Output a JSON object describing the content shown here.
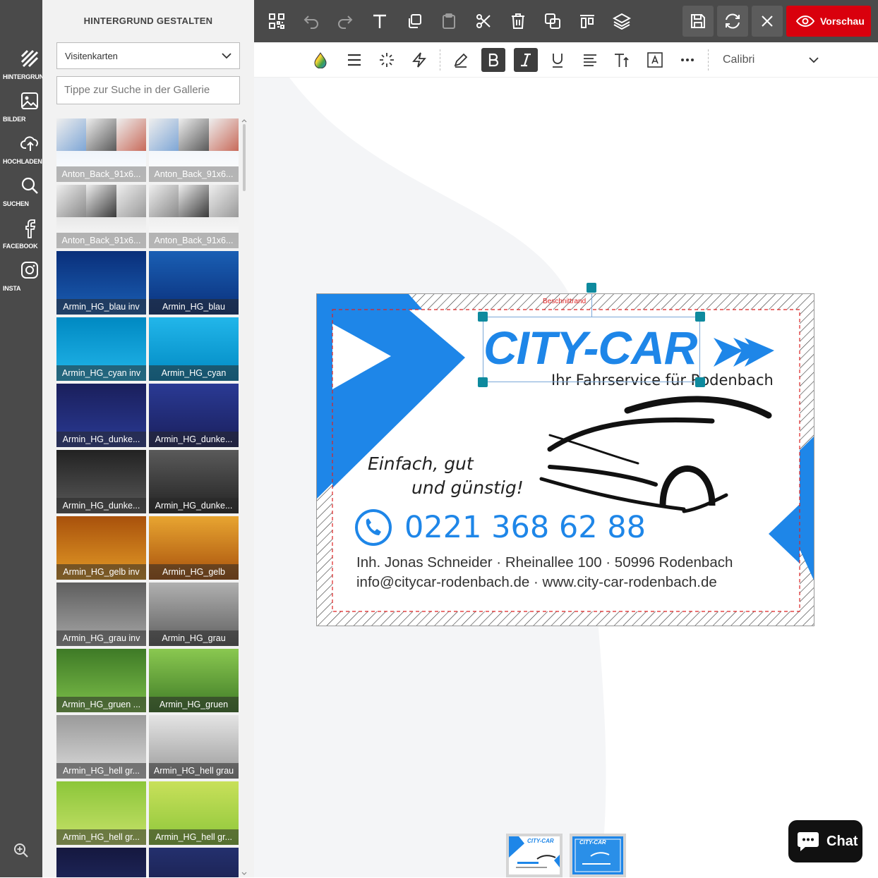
{
  "rail": {
    "items": [
      {
        "label": "HINTERGRUND",
        "icon": "background-stripes-icon"
      },
      {
        "label": "BILDER",
        "icon": "image-icon"
      },
      {
        "label": "HOCHLADEN",
        "icon": "upload-cloud-icon"
      },
      {
        "label": "SUCHEN",
        "icon": "search-icon"
      },
      {
        "label": "FACEBOOK",
        "icon": "facebook-icon"
      },
      {
        "label": "INSTA",
        "icon": "instagram-icon"
      }
    ],
    "zoom_icon": "zoom-in-icon"
  },
  "panel": {
    "title": "HINTERGRUND GESTALTEN",
    "category": "Visitenkarten",
    "search_placeholder": "Tippe zur Suche in der Gallerie",
    "tiles": [
      {
        "caption": "Anton_Back_91x6...",
        "c1": "#dfe9f5",
        "c2": "#ffffff"
      },
      {
        "caption": "Anton_Back_91x6...",
        "c1": "#e8eef6",
        "c2": "#ffffff"
      },
      {
        "caption": "Anton_Back_91x6...",
        "c1": "#cfcfcf",
        "c2": "#ffffff"
      },
      {
        "caption": "Anton_Back_91x6...",
        "c1": "#dcdcdc",
        "c2": "#ffffff"
      },
      {
        "caption": "Armin_HG_blau inv",
        "c1": "#0a2f7a",
        "c2": "#1a5fb4"
      },
      {
        "caption": "Armin_HG_blau",
        "c1": "#1a5fb4",
        "c2": "#0a2f7a"
      },
      {
        "caption": "Armin_HG_cyan inv",
        "c1": "#0089c2",
        "c2": "#22b6ea"
      },
      {
        "caption": "Armin_HG_cyan",
        "c1": "#22b6ea",
        "c2": "#0089c2"
      },
      {
        "caption": "Armin_HG_dunke...",
        "c1": "#1a1f5c",
        "c2": "#2a3a94"
      },
      {
        "caption": "Armin_HG_dunke...",
        "c1": "#2a3a94",
        "c2": "#1a1f5c"
      },
      {
        "caption": "Armin_HG_dunke...",
        "c1": "#222222",
        "c2": "#5a5a5a"
      },
      {
        "caption": "Armin_HG_dunke...",
        "c1": "#5a5a5a",
        "c2": "#222222"
      },
      {
        "caption": "Armin_HG_gelb inv",
        "c1": "#a8510c",
        "c2": "#e39a26"
      },
      {
        "caption": "Armin_HG_gelb",
        "c1": "#e8a531",
        "c2": "#a8510c"
      },
      {
        "caption": "Armin_HG_grau inv",
        "c1": "#5e5e5e",
        "c2": "#a8a8a8"
      },
      {
        "caption": "Armin_HG_grau",
        "c1": "#b0b0b0",
        "c2": "#5e5e5e"
      },
      {
        "caption": "Armin_HG_gruen ...",
        "c1": "#3e7a26",
        "c2": "#7ec04a"
      },
      {
        "caption": "Armin_HG_gruen",
        "c1": "#8ac850",
        "c2": "#3e7a26"
      },
      {
        "caption": "Armin_HG_hell gr...",
        "c1": "#9a9a9a",
        "c2": "#dcdcdc"
      },
      {
        "caption": "Armin_HG_hell grau",
        "c1": "#e4e4e4",
        "c2": "#9a9a9a"
      },
      {
        "caption": "Armin_HG_hell gr...",
        "c1": "#8cc63a",
        "c2": "#c8e26a"
      },
      {
        "caption": "Armin_HG_hell gr...",
        "c1": "#c8e05a",
        "c2": "#8cc63a"
      },
      {
        "caption": "",
        "c1": "#15183f",
        "c2": "#24306e"
      },
      {
        "caption": "",
        "c1": "#24306e",
        "c2": "#15183f"
      }
    ]
  },
  "toolbar": {
    "icons": [
      "qr-code-icon",
      "undo-icon",
      "redo-icon",
      "add-text-icon",
      "copy-icon",
      "paste-icon",
      "cut-icon",
      "delete-icon",
      "duplicate-icon",
      "align-top-icon",
      "layers-icon"
    ],
    "save_icon": "save-icon",
    "reload_icon": "reload-icon",
    "close_icon": "close-icon",
    "preview_label": "Vorschau"
  },
  "format": {
    "font": "Calibri"
  },
  "card": {
    "cut_label": "Beschnittrand",
    "brand": "CITY-CAR",
    "tagline": "Ihr Fahrservice für Rodenbach",
    "slogan_line1": "Einfach, gut",
    "slogan_line2": "und günstig!",
    "phone": "0221 368 62 88",
    "address": "Inh. Jonas Schneider · Rheinallee 100 · 50996 Rodenbach",
    "contact": "info@citycar-rodenbach.de · www.city-car-rodenbach.de",
    "brand_color": "#1e86e8"
  },
  "pages": [
    {
      "label": "CITY-CAR"
    },
    {
      "label": "CITY-CAR"
    }
  ],
  "chat": {
    "label": "Chat"
  }
}
